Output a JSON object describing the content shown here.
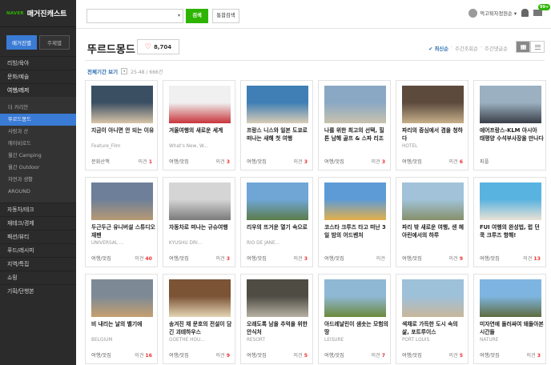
{
  "sidebar": {
    "brand": "NAVER",
    "title": "매거진캐스트",
    "tabs": [
      "매거진별",
      "주제별"
    ],
    "menu_top": [
      "리빙/육아",
      "문화/예술",
      "여행/레저"
    ],
    "sub_items": [
      "더 카리안",
      "뚜르드몽드",
      "사람과 산",
      "에이비로드",
      "월간 Camping",
      "월간 Outdoor",
      "자연과 생활",
      "AROUND"
    ],
    "menu_bottom": [
      "자동차/테크",
      "재테크/경제",
      "패션/뷰티",
      "푸드/레시피",
      "지역/특집",
      "쇼핑",
      "기획/단행본"
    ]
  },
  "search": {
    "dropdown": "▾",
    "button": "검색",
    "total_button": "통합검색"
  },
  "user": {
    "name": "먹고튀자정원순 ▾",
    "badge": "99+"
  },
  "header": {
    "title": "뚜르드몽드",
    "likes": "8,704"
  },
  "sort": [
    "✔ 최신순",
    "·",
    "주간조회순",
    "·",
    "주간댓글순"
  ],
  "filter": {
    "label": "전체기간 보기",
    "dropdown": "▾",
    "count": "25-48 / 666건"
  },
  "cards": [
    {
      "title": "지금이 아니면 안 되는 이유",
      "source": "Feature_Film",
      "category": "문화산책",
      "comment_label": "의견",
      "comments": "1",
      "thumb": [
        "#3b4f63",
        "#d8c5a8"
      ]
    },
    {
      "title": "겨울여행의 새로운 세계",
      "source": "What's New, W...",
      "category": "여행/맛집",
      "comment_label": "의견",
      "comments": "3",
      "thumb": [
        "#f0f0f0",
        "#c8353a"
      ]
    },
    {
      "title": "프랑스 니스와 일본 도쿄로 떠나는 새해 첫 여행",
      "source": "",
      "category": "여행/맛집",
      "comment_label": "의견",
      "comments": "3",
      "thumb": [
        "#3f7fb5",
        "#d9cdb5"
      ]
    },
    {
      "title": "나를 위한 최고의 선택, 힐튼 남해 골프 & 스파 리조트",
      "source": "",
      "category": "여행/맛집",
      "comment_label": "의견",
      "comments": "3",
      "thumb": [
        "#8aa8c4",
        "#c9c2ae"
      ]
    },
    {
      "title": "파리의 중심에서 겸을 청하다",
      "source": "HOTEL",
      "category": "여행/맛집",
      "comment_label": "의견",
      "comments": "6",
      "thumb": [
        "#5c4a3d",
        "#c6b08a"
      ]
    },
    {
      "title": "에어프랑스-KLM 아시아 태평양 수석부사장을 만나다",
      "source": "",
      "category": "피플",
      "comment_label": "",
      "comments": "",
      "thumb": [
        "#9bb0c0",
        "#3a3f49"
      ]
    },
    {
      "title": "두근두근 유니버설 스튜디오 재팬",
      "source": "UNIVERSAL ...",
      "category": "여행/맛집",
      "comment_label": "의견",
      "comments": "40",
      "thumb": [
        "#6d7f99",
        "#b89a74"
      ]
    },
    {
      "title": "자동차로 떠나는 규슈여행",
      "source": "KYUSHU DRI...",
      "category": "여행/맛집",
      "comment_label": "의견",
      "comments": "3",
      "thumb": [
        "#d5d5d5",
        "#7a7a7a"
      ]
    },
    {
      "title": "리우의 뜨거운 열기 속으로",
      "source": "RIO DE JANE...",
      "category": "여행/맛집",
      "comment_label": "의견",
      "comments": "3",
      "thumb": [
        "#6fa6d6",
        "#5b7c4a"
      ]
    },
    {
      "title": "코스타 크루즈 타고 떠난 3일 밤의 어드벤처",
      "source": "",
      "category": "여행/맛집",
      "comment_label": "의견",
      "comments": "",
      "thumb": [
        "#5d9bd6",
        "#e3b04a"
      ]
    },
    {
      "title": "파리 밖 새로운 여행, 샌 헤아린에서의 하루",
      "source": "",
      "category": "여행/맛집",
      "comment_label": "의견",
      "comments": "9",
      "thumb": [
        "#a1c2d9",
        "#86906a"
      ]
    },
    {
      "title": "FUI 여행의 완성법, 럽 던 쿡 크루즈 항해!",
      "source": "",
      "category": "여행/맛집",
      "comment_label": "의견",
      "comments": "13",
      "thumb": [
        "#59b3e0",
        "#e9e2d5"
      ]
    },
    {
      "title": "비 내리는 날의 벨기에",
      "source": "BELGIUM",
      "category": "여행/맛집",
      "comment_label": "의견",
      "comments": "16",
      "thumb": [
        "#7d8a96",
        "#c5a06f"
      ]
    },
    {
      "title": "송겨진 채 문호의 전설이 담긴 괴테하우스",
      "source": "GOETHE HOU...",
      "category": "여행/맛집",
      "comment_label": "의견",
      "comments": "9",
      "thumb": [
        "#7b5335",
        "#e4d4b5"
      ]
    },
    {
      "title": "오래도록 남을 추억을 위한 안식처",
      "source": "RESORT",
      "category": "여행/맛집",
      "comment_label": "의견",
      "comments": "5",
      "thumb": [
        "#4f4c44",
        "#b7b1a3"
      ]
    },
    {
      "title": "아드레날린이 샘솟는 모험의 땅",
      "source": "LEISURE",
      "category": "여행/맛집",
      "comment_label": "의견",
      "comments": "7",
      "thumb": [
        "#8fb8d4",
        "#6c8a3c"
      ]
    },
    {
      "title": "색채로 가득한 도시 속의 삶, 포트루이스",
      "source": "PORT LOUIS",
      "category": "여행/맛집",
      "comment_label": "의견",
      "comments": "5",
      "thumb": [
        "#9ec1da",
        "#c9b79a"
      ]
    },
    {
      "title": "미자연에 둘러싸여 돼돌아본 시간들",
      "source": "NATURE",
      "category": "여행/맛집",
      "comment_label": "의견",
      "comments": "3",
      "thumb": [
        "#7eb5e0",
        "#5f6b3f"
      ]
    }
  ]
}
